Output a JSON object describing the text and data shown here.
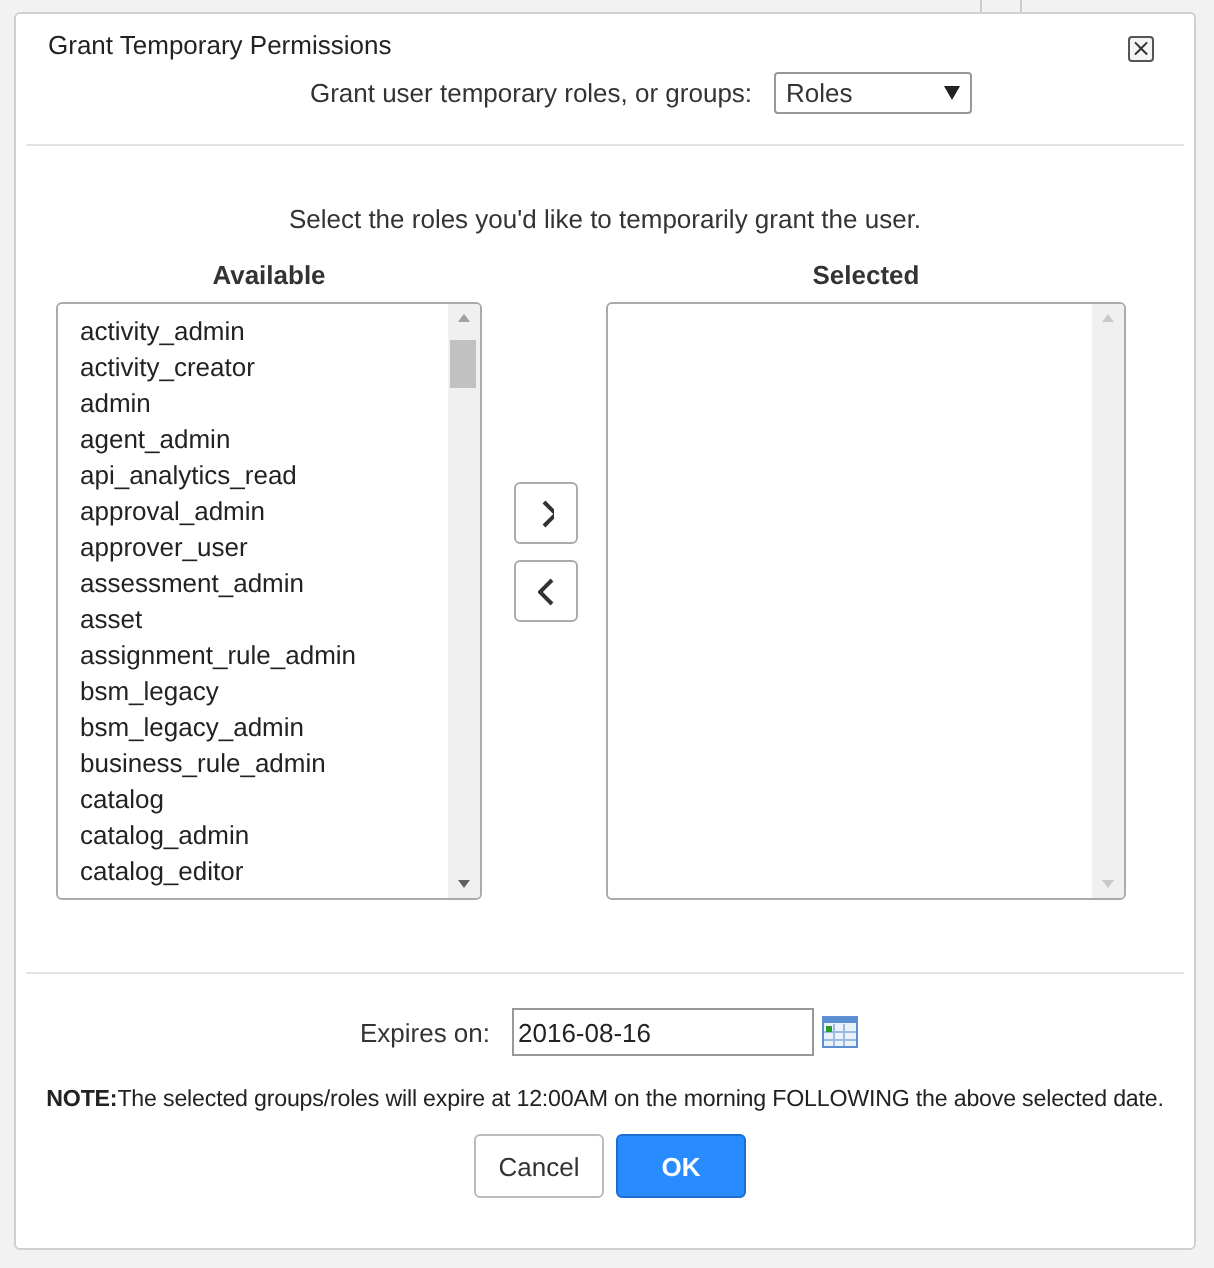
{
  "dialog": {
    "title": "Grant Temporary Permissions",
    "close_label": "×"
  },
  "grant_type": {
    "label": "Grant user temporary roles, or groups:",
    "value": "Roles"
  },
  "instruction": "Select the roles you'd like to temporarily grant the user.",
  "available": {
    "heading": "Available",
    "items": [
      "activity_admin",
      "activity_creator",
      "admin",
      "agent_admin",
      "api_analytics_read",
      "approval_admin",
      "approver_user",
      "assessment_admin",
      "asset",
      "assignment_rule_admin",
      "bsm_legacy",
      "bsm_legacy_admin",
      "business_rule_admin",
      "catalog",
      "catalog_admin",
      "catalog_editor"
    ]
  },
  "selected": {
    "heading": "Selected"
  },
  "move_buttons": [
    {
      "kind": "add"
    },
    {
      "kind": "remove"
    }
  ],
  "expires": {
    "label": "Expires on:",
    "value": "2016-08-16"
  },
  "note": "**NOTE:**The selected groups/roles will expire at 12:00AM on the morning FOLLOWING the above selected date.",
  "buttons": [
    {
      "label": "Cancel",
      "kind": "secondary"
    },
    {
      "label": "OK",
      "kind": "primary"
    }
  ]
}
